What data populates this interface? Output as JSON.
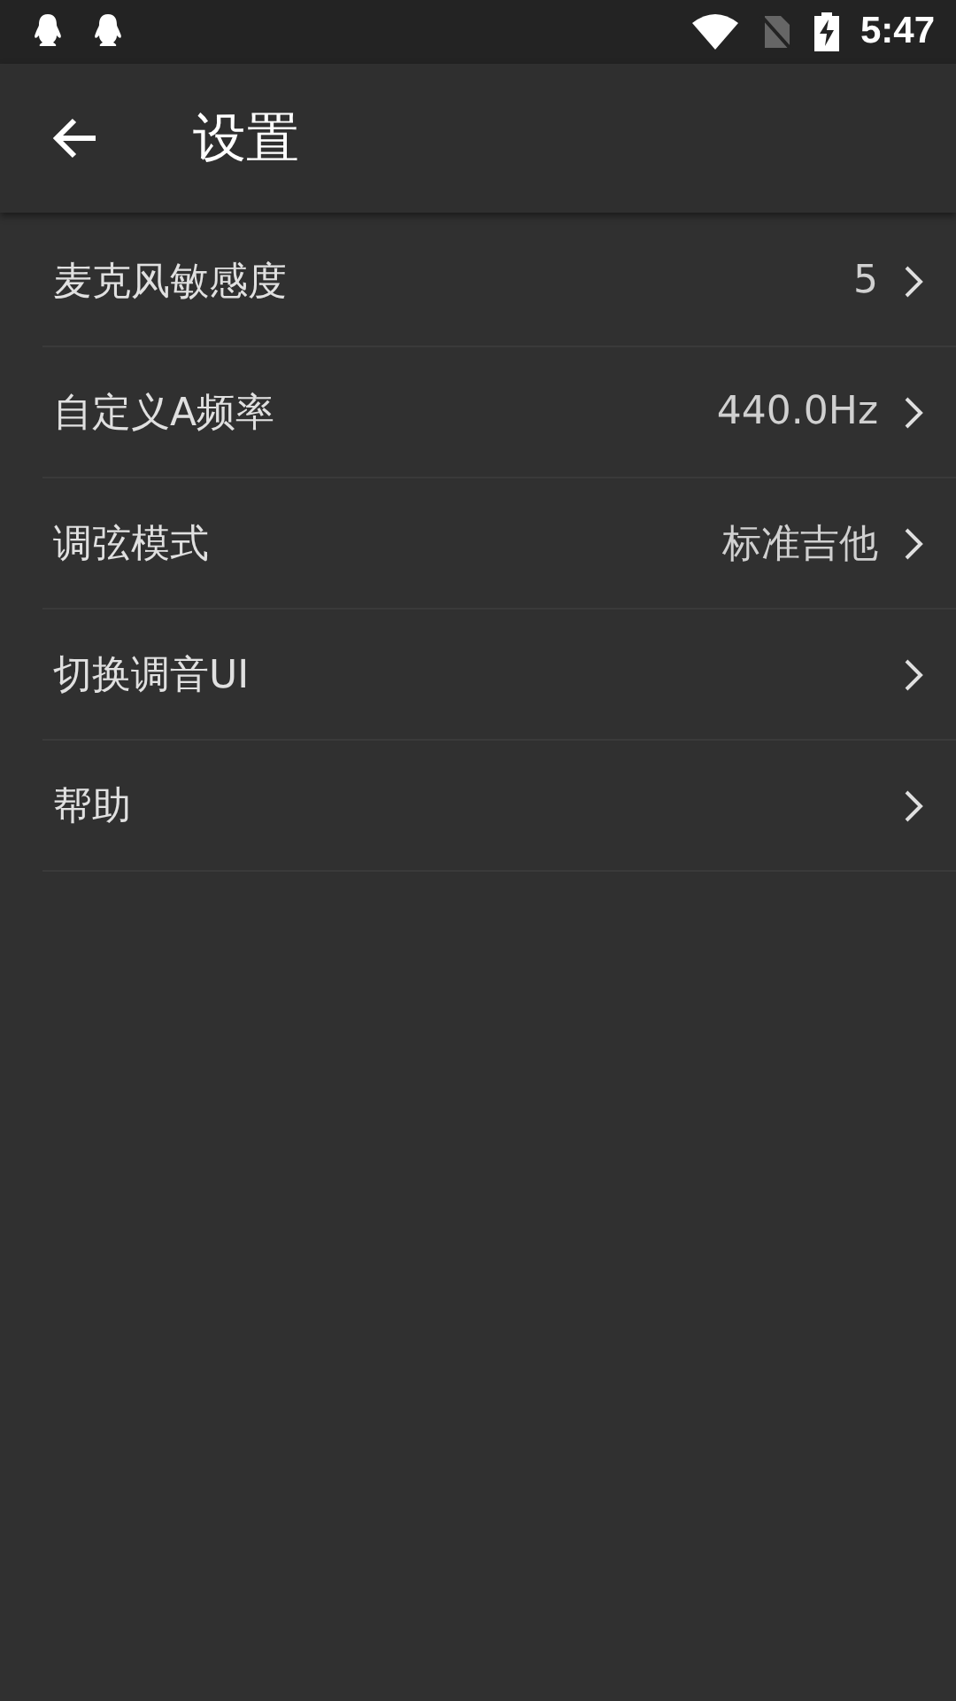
{
  "status_bar": {
    "time": "5:47"
  },
  "app_bar": {
    "title": "设置"
  },
  "settings": [
    {
      "label": "麦克风敏感度",
      "value": "5"
    },
    {
      "label": "自定义A频率",
      "value": "440.0Hz"
    },
    {
      "label": "调弦模式",
      "value": "标准吉他"
    },
    {
      "label": "切换调音UI"
    },
    {
      "label": "帮助"
    }
  ]
}
